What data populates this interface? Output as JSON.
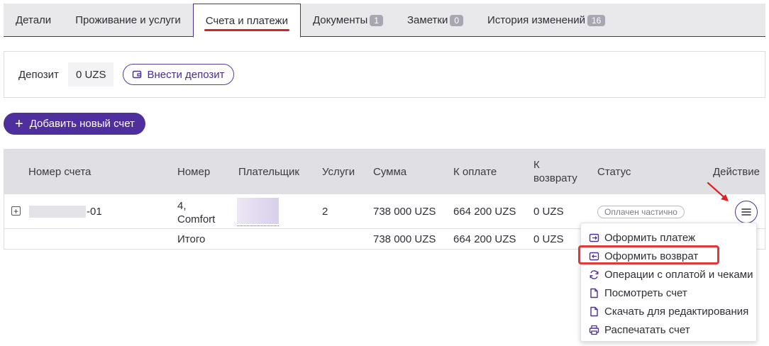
{
  "tabs": [
    {
      "label": "Детали"
    },
    {
      "label": "Проживание и услуги"
    },
    {
      "label": "Счета и платежи",
      "active": true
    },
    {
      "label": "Документы",
      "badge": "1"
    },
    {
      "label": "Заметки",
      "badge": "0"
    },
    {
      "label": "История изменений",
      "badge": "16"
    }
  ],
  "deposit": {
    "label": "Депозит",
    "value": "0 UZS",
    "button_label": "Внести депозит"
  },
  "add_invoice": {
    "label": "Добавить новый счет"
  },
  "table": {
    "headers": {
      "number": "Номер счета",
      "room": "Номер",
      "payer": "Плательщик",
      "services": "Услуги",
      "amount": "Сумма",
      "to_pay": "К оплате",
      "refund_line1": "К",
      "refund_line2": "возврату",
      "status": "Статус",
      "action": "Действие"
    },
    "row": {
      "expand": "+",
      "number_suffix": "-01",
      "room_line1": "4,",
      "room_line2": "Comfort",
      "services": "2",
      "amount": "738 000 UZS",
      "to_pay": "664 200 UZS",
      "refund": "0 UZS",
      "status": "Оплачен частично"
    },
    "total": {
      "label": "Итого",
      "amount": "738 000 UZS",
      "to_pay": "664 200 UZS",
      "refund": "0 UZS"
    }
  },
  "menu": {
    "items": [
      {
        "label": "Оформить платеж",
        "icon": "payment-icon"
      },
      {
        "label": "Оформить возврат",
        "icon": "refund-icon"
      },
      {
        "label": "Операции с оплатой и чеками",
        "icon": "sync-icon"
      },
      {
        "label": "Посмотреть счет",
        "icon": "document-icon"
      },
      {
        "label": "Скачать для редактирования",
        "icon": "document-icon"
      },
      {
        "label": "Распечатать счет",
        "icon": "printer-icon"
      }
    ]
  },
  "colors": {
    "accent": "#4f2e9d",
    "highlight": "#de3a3a"
  }
}
